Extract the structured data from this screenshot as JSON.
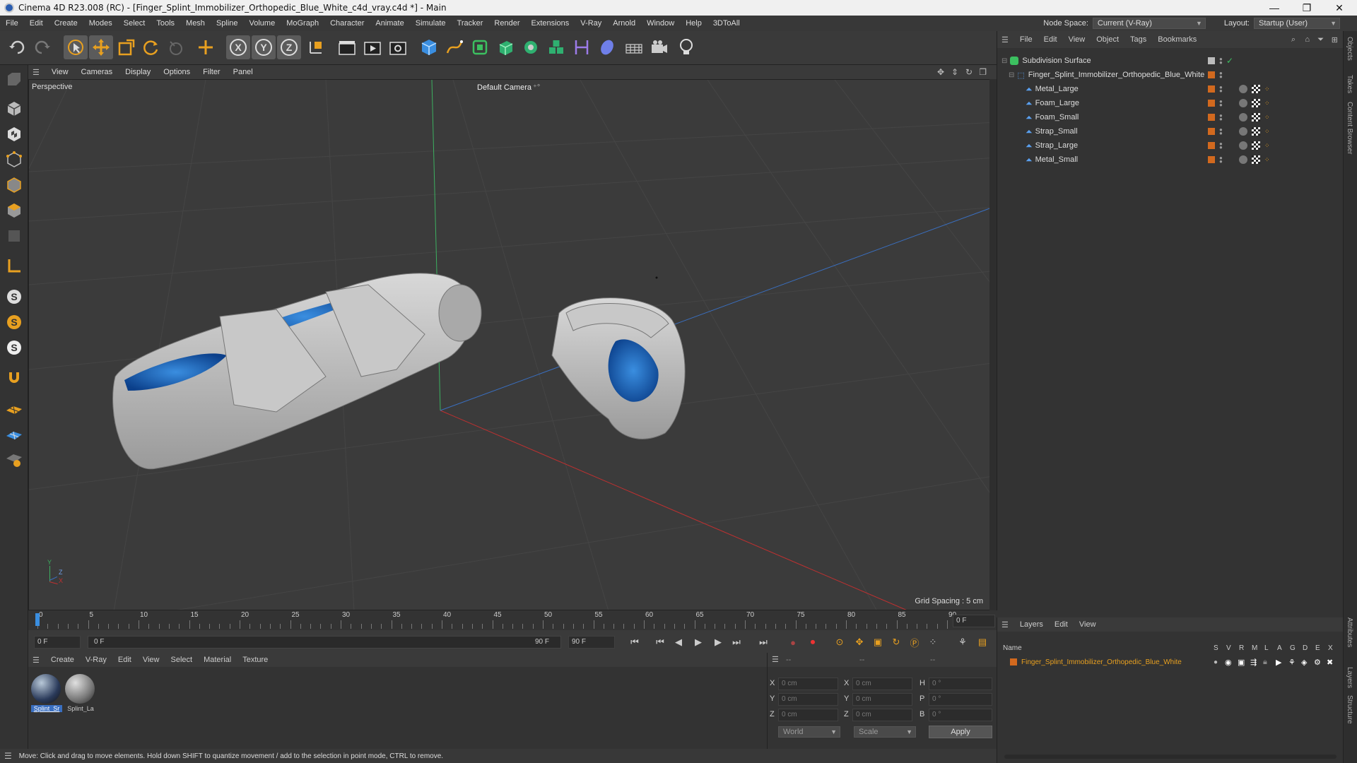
{
  "window": {
    "title": "Cinema 4D R23.008 (RC) - [Finger_Splint_Immobilizer_Orthopedic_Blue_White_c4d_vray.c4d *] - Main",
    "minimize": "—",
    "maximize": "❐",
    "close": "✕"
  },
  "menubar": {
    "items": [
      "File",
      "Edit",
      "Create",
      "Modes",
      "Select",
      "Tools",
      "Mesh",
      "Spline",
      "Volume",
      "MoGraph",
      "Character",
      "Animate",
      "Simulate",
      "Tracker",
      "Render",
      "Extensions",
      "V-Ray",
      "Arnold",
      "Window",
      "Help",
      "3DToAll"
    ],
    "node_space_label": "Node Space:",
    "node_space_value": "Current (V-Ray)",
    "layout_label": "Layout:",
    "layout_value": "Startup (User)"
  },
  "viewport": {
    "menu": [
      "View",
      "Cameras",
      "Display",
      "Options",
      "Filter",
      "Panel"
    ],
    "projection": "Perspective",
    "camera": "Default Camera",
    "grid_spacing": "Grid Spacing : 5 cm",
    "axis_y": "Y",
    "axis_z": "Z",
    "axis_x": "X"
  },
  "timeline": {
    "ticks": [
      "0",
      "5",
      "10",
      "15",
      "20",
      "25",
      "30",
      "35",
      "40",
      "45",
      "50",
      "55",
      "60",
      "65",
      "70",
      "75",
      "80",
      "85",
      "90"
    ],
    "current_frame": "0 F"
  },
  "transport": {
    "start_frame": "0 F",
    "range_start": "0 F",
    "range_end": "90 F",
    "end_frame": "90 F"
  },
  "material_manager": {
    "menu": [
      "Create",
      "V-Ray",
      "Edit",
      "View",
      "Select",
      "Material",
      "Texture"
    ],
    "materials": [
      {
        "name": "Splint_Sr",
        "selected": true
      },
      {
        "name": "Splint_La",
        "selected": false
      }
    ]
  },
  "coordinates": {
    "header": [
      "--",
      "--",
      "--"
    ],
    "rows": [
      {
        "axis": "X",
        "pos": "0 cm",
        "axis2": "X",
        "size": "0 cm",
        "axis3": "H",
        "rot": "0 °"
      },
      {
        "axis": "Y",
        "pos": "0 cm",
        "axis2": "Y",
        "size": "0 cm",
        "axis3": "P",
        "rot": "0 °"
      },
      {
        "axis": "Z",
        "pos": "0 cm",
        "axis2": "Z",
        "size": "0 cm",
        "axis3": "B",
        "rot": "0 °"
      }
    ],
    "space": "World",
    "mode": "Scale",
    "apply": "Apply"
  },
  "status": {
    "text": "Move: Click and drag to move elements. Hold down SHIFT to quantize movement / add to the selection in point mode, CTRL to remove."
  },
  "object_manager": {
    "menu": [
      "File",
      "Edit",
      "View",
      "Object",
      "Tags",
      "Bookmarks"
    ],
    "objects": [
      {
        "name": "Subdivision Surface",
        "depth": 0,
        "icon": "subdivision-icon",
        "tag": "check"
      },
      {
        "name": "Finger_Splint_Immobilizer_Orthopedic_Blue_White",
        "depth": 1,
        "icon": "null-icon",
        "tag": "none"
      },
      {
        "name": "Metal_Large",
        "depth": 2,
        "icon": "polygon-icon",
        "tag": "materials"
      },
      {
        "name": "Foam_Large",
        "depth": 2,
        "icon": "polygon-icon",
        "tag": "materials"
      },
      {
        "name": "Foam_Small",
        "depth": 2,
        "icon": "polygon-icon",
        "tag": "materials"
      },
      {
        "name": "Strap_Small",
        "depth": 2,
        "icon": "polygon-icon",
        "tag": "materials"
      },
      {
        "name": "Strap_Large",
        "depth": 2,
        "icon": "polygon-icon",
        "tag": "materials"
      },
      {
        "name": "Metal_Small",
        "depth": 2,
        "icon": "polygon-icon",
        "tag": "materials"
      }
    ]
  },
  "layers": {
    "menu": [
      "Layers",
      "Edit",
      "View"
    ],
    "name_header": "Name",
    "flags": [
      "S",
      "V",
      "R",
      "M",
      "L",
      "A",
      "G",
      "D",
      "E",
      "X"
    ],
    "items": [
      {
        "name": "Finger_Splint_Immobilizer_Orthopedic_Blue_White",
        "color": "#d2691e"
      }
    ]
  },
  "side_tabs": [
    "Objects",
    "Takes",
    "Content Browser",
    "Attributes",
    "Layers",
    "Structure"
  ],
  "colors": {
    "accent_orange": "#e8a020",
    "layer_text": "#e8a020",
    "foam_blue": "#1a6fc0"
  }
}
